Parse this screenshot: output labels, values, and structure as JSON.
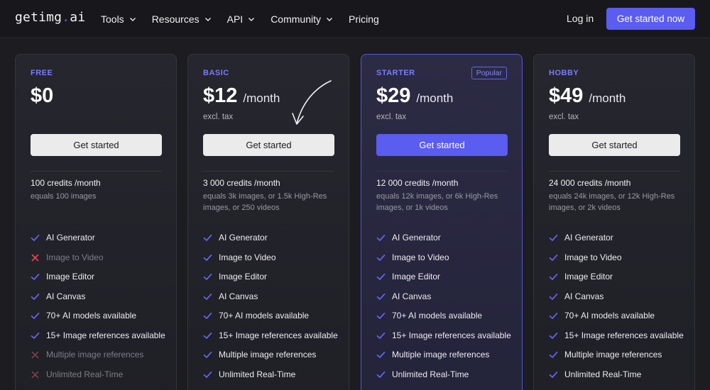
{
  "nav": {
    "logo_main": "getimg",
    "logo_dot": ".",
    "logo_tld": "ai",
    "links": [
      {
        "label": "Tools",
        "dropdown": true
      },
      {
        "label": "Resources",
        "dropdown": true
      },
      {
        "label": "API",
        "dropdown": true
      },
      {
        "label": "Community",
        "dropdown": true
      },
      {
        "label": "Pricing",
        "dropdown": false
      }
    ],
    "login": "Log in",
    "cta": "Get started now"
  },
  "colors": {
    "accent": "#5b5cf0",
    "background": "#1c1c21",
    "check": "#6366f1",
    "cross": "#e5484d"
  },
  "plans": [
    {
      "name": "FREE",
      "price": "$0",
      "per": "",
      "tax": "",
      "button": "Get started",
      "credits": "100 credits /month",
      "equals": "equals 100 images",
      "featured": false,
      "features": [
        {
          "label": "AI Generator",
          "included": true
        },
        {
          "label": "Image to Video",
          "included": false
        },
        {
          "label": "Image Editor",
          "included": true
        },
        {
          "label": "AI Canvas",
          "included": true
        },
        {
          "label": "70+ AI models available",
          "included": true
        },
        {
          "label": "15+ Image references available",
          "included": true
        },
        {
          "label": "Multiple image references",
          "included": false
        },
        {
          "label": "Unlimited Real-Time",
          "included": false
        }
      ]
    },
    {
      "name": "BASIC",
      "price": "$12",
      "per": "/month",
      "tax": "excl. tax",
      "button": "Get started",
      "credits": "3 000 credits /month",
      "equals": "equals 3k images, or 1.5k High-Res images, or 250 videos",
      "featured": false,
      "features": [
        {
          "label": "AI Generator",
          "included": true
        },
        {
          "label": "Image to Video",
          "included": true
        },
        {
          "label": "Image Editor",
          "included": true
        },
        {
          "label": "AI Canvas",
          "included": true
        },
        {
          "label": "70+ AI models available",
          "included": true
        },
        {
          "label": "15+ Image references available",
          "included": true
        },
        {
          "label": "Multiple image references",
          "included": true
        },
        {
          "label": "Unlimited Real-Time",
          "included": true
        }
      ]
    },
    {
      "name": "STARTER",
      "badge": "Popular",
      "price": "$29",
      "per": "/month",
      "tax": "excl. tax",
      "button": "Get started",
      "credits": "12 000 credits /month",
      "equals": "equals 12k images, or 6k High-Res images, or 1k videos",
      "featured": true,
      "features": [
        {
          "label": "AI Generator",
          "included": true
        },
        {
          "label": "Image to Video",
          "included": true
        },
        {
          "label": "Image Editor",
          "included": true
        },
        {
          "label": "AI Canvas",
          "included": true
        },
        {
          "label": "70+ AI models available",
          "included": true
        },
        {
          "label": "15+ Image references available",
          "included": true
        },
        {
          "label": "Multiple image references",
          "included": true
        },
        {
          "label": "Unlimited Real-Time",
          "included": true
        }
      ]
    },
    {
      "name": "HOBBY",
      "price": "$49",
      "per": "/month",
      "tax": "excl. tax",
      "button": "Get started",
      "credits": "24 000 credits /month",
      "equals": "equals 24k images, or 12k High-Res images, or 2k videos",
      "featured": false,
      "features": [
        {
          "label": "AI Generator",
          "included": true
        },
        {
          "label": "Image to Video",
          "included": true
        },
        {
          "label": "Image Editor",
          "included": true
        },
        {
          "label": "AI Canvas",
          "included": true
        },
        {
          "label": "70+ AI models available",
          "included": true
        },
        {
          "label": "15+ Image references available",
          "included": true
        },
        {
          "label": "Multiple image references",
          "included": true
        },
        {
          "label": "Unlimited Real-Time",
          "included": true
        }
      ]
    }
  ]
}
